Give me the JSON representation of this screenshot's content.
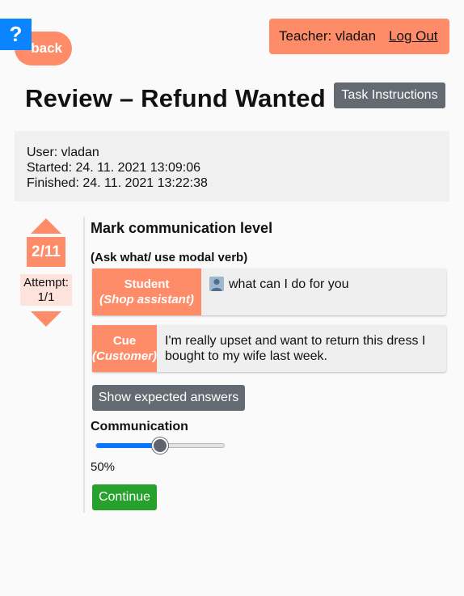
{
  "help": {
    "label": "?"
  },
  "nav": {
    "back_label": "back"
  },
  "header": {
    "teacher_text": "Teacher: vladan",
    "logout_label": "Log Out"
  },
  "page": {
    "title": "Review – Refund Wanted",
    "instructions_label": "Task Instructions"
  },
  "info": {
    "user": "User: vladan",
    "started": "Started: 24. 11. 2021 13:09:06",
    "finished": "Finished: 24. 11. 2021 13:22:38"
  },
  "navigator": {
    "counter": "2/11",
    "attempt_label": "Attempt:",
    "attempt_value": "1/1"
  },
  "task": {
    "title": "Mark communication level",
    "subtitle": "(Ask what/ use modal verb)",
    "rows": [
      {
        "role": "Student",
        "role_sub": "(Shop assistant)",
        "text": "what can I do for you",
        "icon": "user-icon"
      },
      {
        "role": "Cue",
        "role_sub": "(Customer)",
        "text": "I'm really upset and want to return this dress I bought to my wife last week."
      }
    ],
    "expected_label": "Show expected answers"
  },
  "communication": {
    "label": "Communication",
    "value_text": "50%",
    "value": 0.5,
    "accent": "#0a74ff"
  },
  "actions": {
    "continue_label": "Continue"
  },
  "colors": {
    "accent_orange": "#ff8c69",
    "help_blue": "#0a84ff",
    "continue_green": "#28a02c",
    "gray_button": "#636a72"
  }
}
